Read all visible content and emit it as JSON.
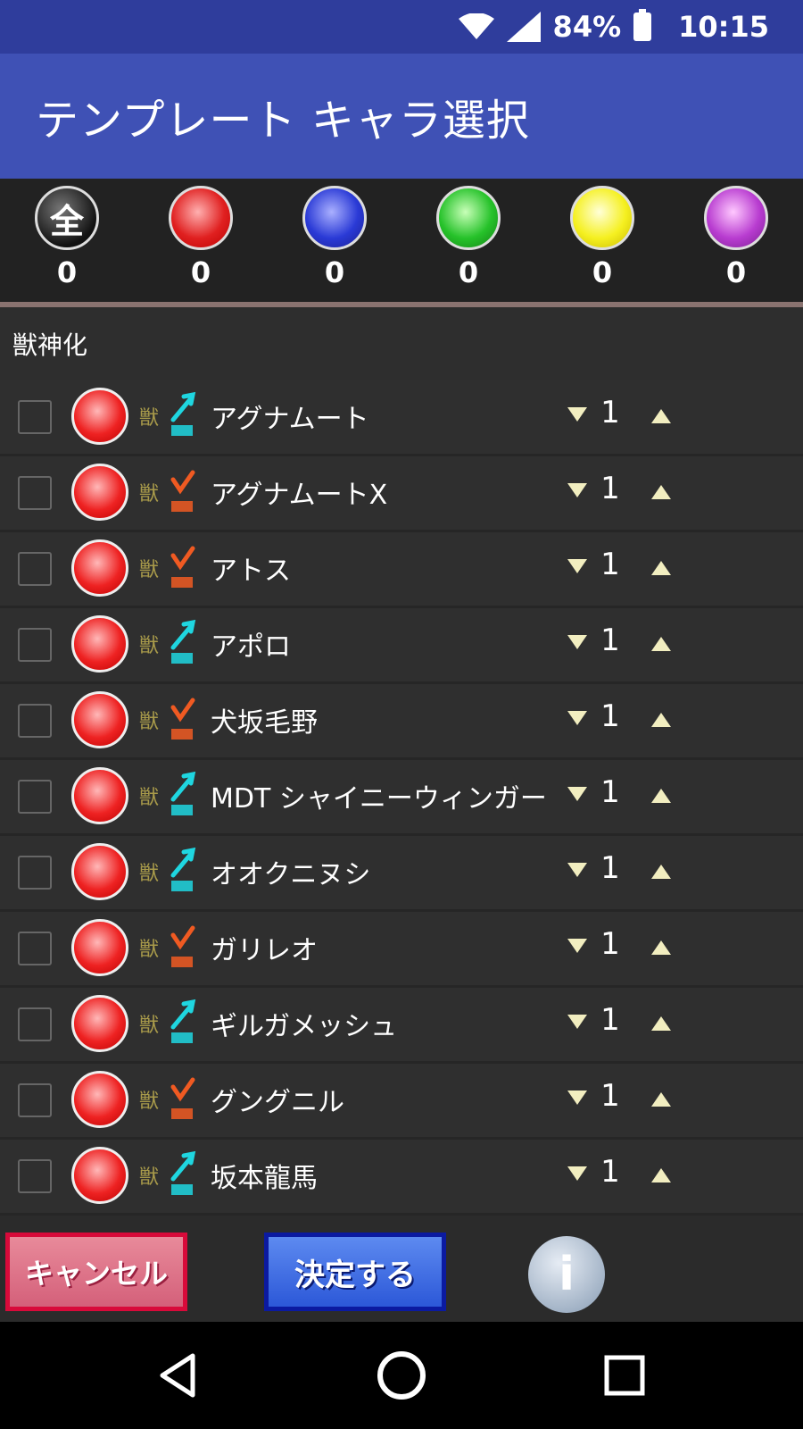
{
  "status_bar": {
    "battery": "84%",
    "time": "10:15"
  },
  "app_bar": {
    "title": "テンプレート キャラ選択"
  },
  "filters": [
    {
      "label": "全",
      "color": "all",
      "count": "0"
    },
    {
      "label": "",
      "color": "red",
      "count": "0"
    },
    {
      "label": "",
      "color": "blue",
      "count": "0"
    },
    {
      "label": "",
      "color": "green",
      "count": "0"
    },
    {
      "label": "",
      "color": "yellow",
      "count": "0"
    },
    {
      "label": "",
      "color": "purple",
      "count": "0"
    }
  ],
  "section": {
    "title": "獣神化"
  },
  "rows": [
    {
      "type_label": "獣",
      "shot_type": "pierce",
      "name": "アグナムート",
      "qty": "1"
    },
    {
      "type_label": "獣",
      "shot_type": "bounce",
      "name": "アグナムートX",
      "qty": "1"
    },
    {
      "type_label": "獣",
      "shot_type": "bounce",
      "name": "アトス",
      "qty": "1"
    },
    {
      "type_label": "獣",
      "shot_type": "pierce",
      "name": "アポロ",
      "qty": "1"
    },
    {
      "type_label": "獣",
      "shot_type": "bounce",
      "name": "犬坂毛野",
      "qty": "1"
    },
    {
      "type_label": "獣",
      "shot_type": "pierce",
      "name": "MDT シャイニーウィンガー",
      "qty": "1"
    },
    {
      "type_label": "獣",
      "shot_type": "pierce",
      "name": "オオクニヌシ",
      "qty": "1"
    },
    {
      "type_label": "獣",
      "shot_type": "bounce",
      "name": "ガリレオ",
      "qty": "1"
    },
    {
      "type_label": "獣",
      "shot_type": "pierce",
      "name": "ギルガメッシュ",
      "qty": "1"
    },
    {
      "type_label": "獣",
      "shot_type": "bounce",
      "name": "グングニル",
      "qty": "1"
    },
    {
      "type_label": "獣",
      "shot_type": "pierce",
      "name": "坂本龍馬",
      "qty": "1"
    }
  ],
  "buttons": {
    "cancel": "キャンセル",
    "confirm": "決定する",
    "info": "i"
  },
  "colors": {
    "app_bar": "#3f51b5",
    "status_bar": "#2f3d9c",
    "pierce": "#1fd6e0",
    "bounce": "#f05a22",
    "cancel_border": "#d80a3a",
    "confirm_border": "#0b1aa0"
  }
}
